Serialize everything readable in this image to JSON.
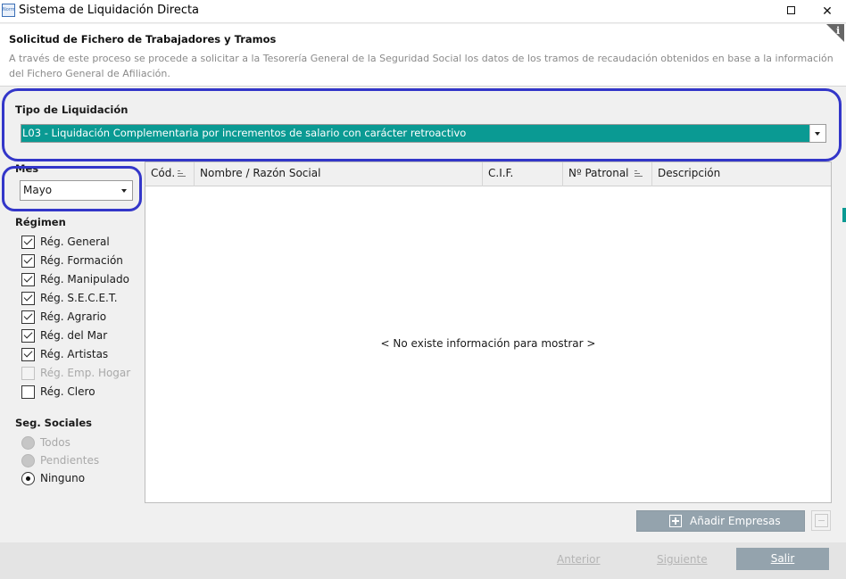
{
  "window": {
    "icon_text": "Norm",
    "title": "Sistema de Liquidación Directa",
    "maximize_icon": "maximize-icon",
    "close_icon": "close-icon",
    "close_glyph": "✕"
  },
  "header": {
    "title": "Solicitud de Fichero de Trabajadores y Tramos",
    "description": "A través de este proceso se procede a solicitar a la Tesorería General de la Seguridad Social los datos de los tramos de recaudación obtenidos en base a la información del Fichero General de Afiliación.",
    "info_glyph": "i"
  },
  "tipo_liquidacion": {
    "label": "Tipo de Liquidación",
    "selected": "L03 - Liquidación Complementaria por incrementos de salario con carácter retroactivo"
  },
  "mes": {
    "label": "Mes",
    "selected": "Mayo"
  },
  "regimen": {
    "title": "Régimen",
    "items": [
      {
        "label": "Rég. General",
        "checked": true,
        "disabled": false
      },
      {
        "label": "Rég. Formación",
        "checked": true,
        "disabled": false
      },
      {
        "label": "Rég. Manipulado",
        "checked": true,
        "disabled": false
      },
      {
        "label": "Rég. S.E.C.E.T.",
        "checked": true,
        "disabled": false
      },
      {
        "label": "Rég. Agrario",
        "checked": true,
        "disabled": false
      },
      {
        "label": "Rég. del Mar",
        "checked": true,
        "disabled": false
      },
      {
        "label": "Rég. Artistas",
        "checked": true,
        "disabled": false
      },
      {
        "label": "Rég. Emp. Hogar",
        "checked": false,
        "disabled": true
      },
      {
        "label": "Rég. Clero",
        "checked": false,
        "disabled": false
      }
    ]
  },
  "seg_sociales": {
    "title": "Seg. Sociales",
    "options": [
      {
        "label": "Todos",
        "selected": false,
        "disabled": true
      },
      {
        "label": "Pendientes",
        "selected": false,
        "disabled": true
      },
      {
        "label": "Ninguno",
        "selected": true,
        "disabled": false
      }
    ]
  },
  "grid": {
    "columns": [
      "Cód.",
      "Nombre / Razón Social",
      "C.I.F.",
      "Nº Patronal",
      "Descripción"
    ],
    "empty_message": "< No existe información para mostrar >"
  },
  "actions": {
    "add_companies": "Añadir Empresas",
    "previous": "Anterior",
    "next": "Siguiente",
    "exit": "Salir"
  },
  "colors": {
    "accent_teal": "#0a9a93",
    "highlight_outline": "#3336c9",
    "button_gray": "#94a3ad"
  }
}
